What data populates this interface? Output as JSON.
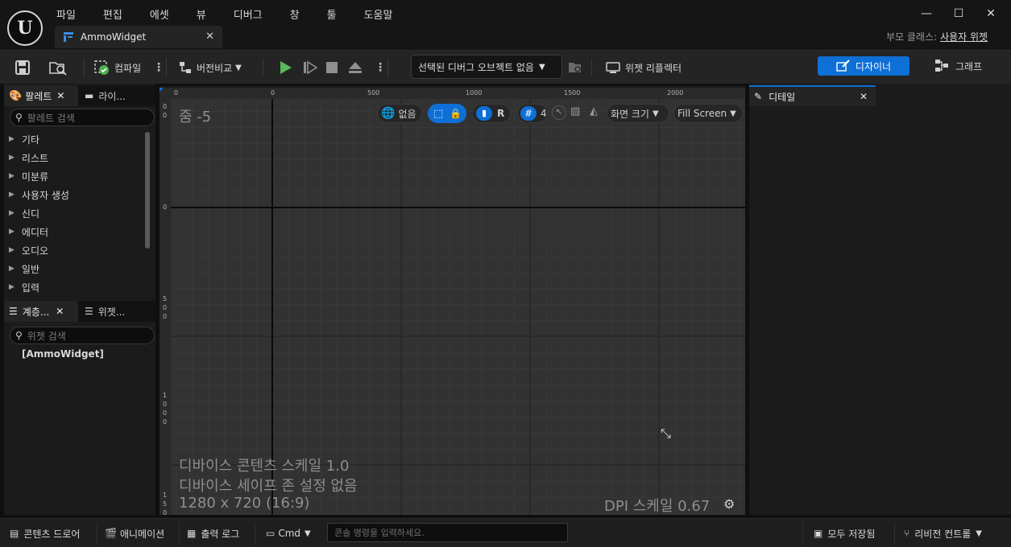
{
  "menu": [
    "파일",
    "편집",
    "에셋",
    "뷰",
    "디버그",
    "창",
    "툴",
    "도움말"
  ],
  "document_tab": "AmmoWidget",
  "parent_class": {
    "label": "부모 클래스:",
    "value": "사용자 위젯"
  },
  "toolbar": {
    "compile": "컴파일",
    "diff": "버전비교",
    "debug_object": "선택된 디버그 오브젝트 없음",
    "widget_reflector": "위젯 리플렉터",
    "designer": "디자이너",
    "graph": "그래프"
  },
  "palette": {
    "tab": "팔레트",
    "library_tab": "라이...",
    "search_placeholder": "팔레트 검색",
    "categories": [
      "기타",
      "리스트",
      "미분류",
      "사용자 생성",
      "신디",
      "에디터",
      "오디오",
      "일반",
      "입력"
    ]
  },
  "hierarchy": {
    "tab": "계층...",
    "bind_tab": "위젯...",
    "search_placeholder": "위젯 검색",
    "root": "[AmmoWidget]"
  },
  "canvas": {
    "zoom": "줌 -5",
    "ruler_top": [
      "0",
      "0",
      "500",
      "1000",
      "1500",
      "2000"
    ],
    "ruler_left": [
      "0",
      "0",
      "0",
      "5",
      "0",
      "0",
      "1",
      "0",
      "0",
      "0",
      "1",
      "5",
      "0"
    ],
    "toolbar": {
      "none": "없음",
      "r": "R",
      "grid": "4",
      "screen_size": "화면 크기",
      "fill": "Fill Screen"
    },
    "info_line1": "디바이스 콘텐츠 스케일 1.0",
    "info_line2": "디바이스 세이프 존 설정 없음",
    "info_line3": "1280 x 720 (16:9)",
    "dpi": "DPI 스케일 0.67"
  },
  "details": {
    "tab": "디테일"
  },
  "statusbar": {
    "content_drawer": "콘텐츠 드로어",
    "animation": "애니메이션",
    "output_log": "출력 로그",
    "cmd": "Cmd",
    "console_placeholder": "콘솔 명령을 입력하세요.",
    "save_all": "모두 저장됨",
    "revision_control": "리비전 컨트롤"
  },
  "colors": {
    "accent": "#0e6fd6",
    "play": "#5cb85c"
  }
}
